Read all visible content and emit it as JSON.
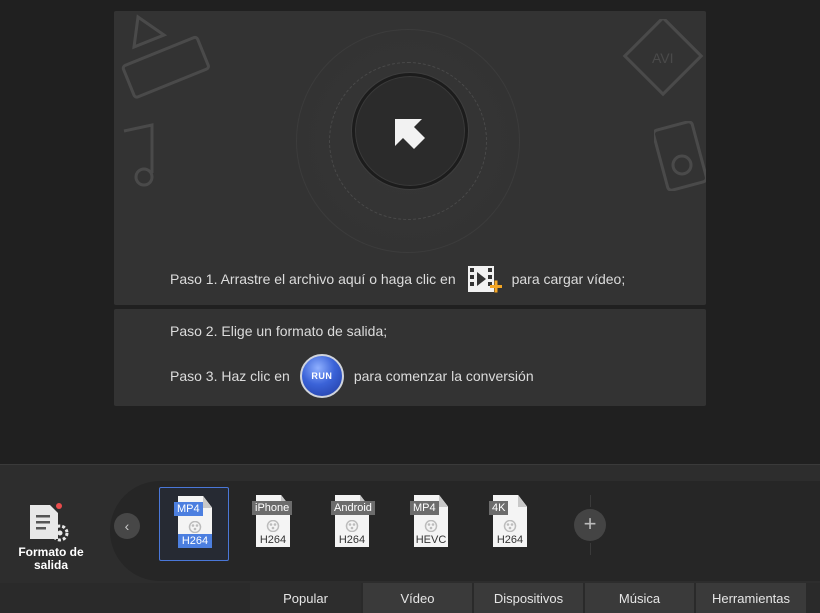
{
  "steps": {
    "step1_before": "Paso 1. Arrastre el archivo aquí o haga clic en",
    "step1_after": "para cargar vídeo;",
    "step2": "Paso 2. Elige un formato de salida;",
    "step3_before": "Paso 3. Haz clic en",
    "step3_after": "para comenzar la conversión",
    "run_label": "RUN"
  },
  "output_format": {
    "label": "Formato de salida",
    "icon": "document-gear-icon"
  },
  "formats": [
    {
      "top": "MP4",
      "bottom": "H264",
      "selected": true
    },
    {
      "top": "iPhone",
      "bottom": "H264",
      "selected": false
    },
    {
      "top": "Android",
      "bottom": "H264",
      "selected": false
    },
    {
      "top": "MP4",
      "bottom": "HEVC",
      "selected": false
    },
    {
      "top": "4K",
      "bottom": "H264",
      "selected": false
    }
  ],
  "tabs": [
    {
      "label": "Popular",
      "active": true
    },
    {
      "label": "Vídeo",
      "active": false
    },
    {
      "label": "Dispositivos",
      "active": false
    },
    {
      "label": "Música",
      "active": false
    },
    {
      "label": "Herramientas",
      "active": false
    }
  ],
  "icons": {
    "upload": "upload-arrow-icon",
    "add_video": "add-video-icon",
    "nav_left": "chevron-left-icon",
    "add_format": "plus-icon"
  },
  "colors": {
    "accent": "#4c7fe0",
    "panel": "#333333",
    "background": "#202020"
  }
}
